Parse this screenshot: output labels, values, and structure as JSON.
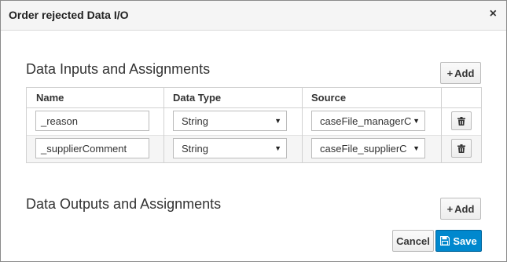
{
  "dialog": {
    "title": "Order rejected Data I/O",
    "close_glyph": "×"
  },
  "inputs_section": {
    "title": "Data Inputs and Assignments",
    "add_label": "Add",
    "columns": [
      "Name",
      "Data Type",
      "Source"
    ],
    "rows": [
      {
        "name": "_reason",
        "data_type": "String",
        "source": "caseFile_managerC"
      },
      {
        "name": "_supplierComment",
        "data_type": "String",
        "source": "caseFile_supplierC"
      }
    ]
  },
  "outputs_section": {
    "title": "Data Outputs and Assignments",
    "add_label": "Add"
  },
  "footer": {
    "cancel_label": "Cancel",
    "save_label": "Save"
  },
  "icons": {
    "add": "plus-icon",
    "delete": "trash-icon",
    "save": "floppy-disk-icon",
    "dropdown": "caret-down-icon"
  },
  "colors": {
    "primary": "#0088ce",
    "header_bg": "#f5f5f5",
    "border": "#d1d1d1"
  }
}
